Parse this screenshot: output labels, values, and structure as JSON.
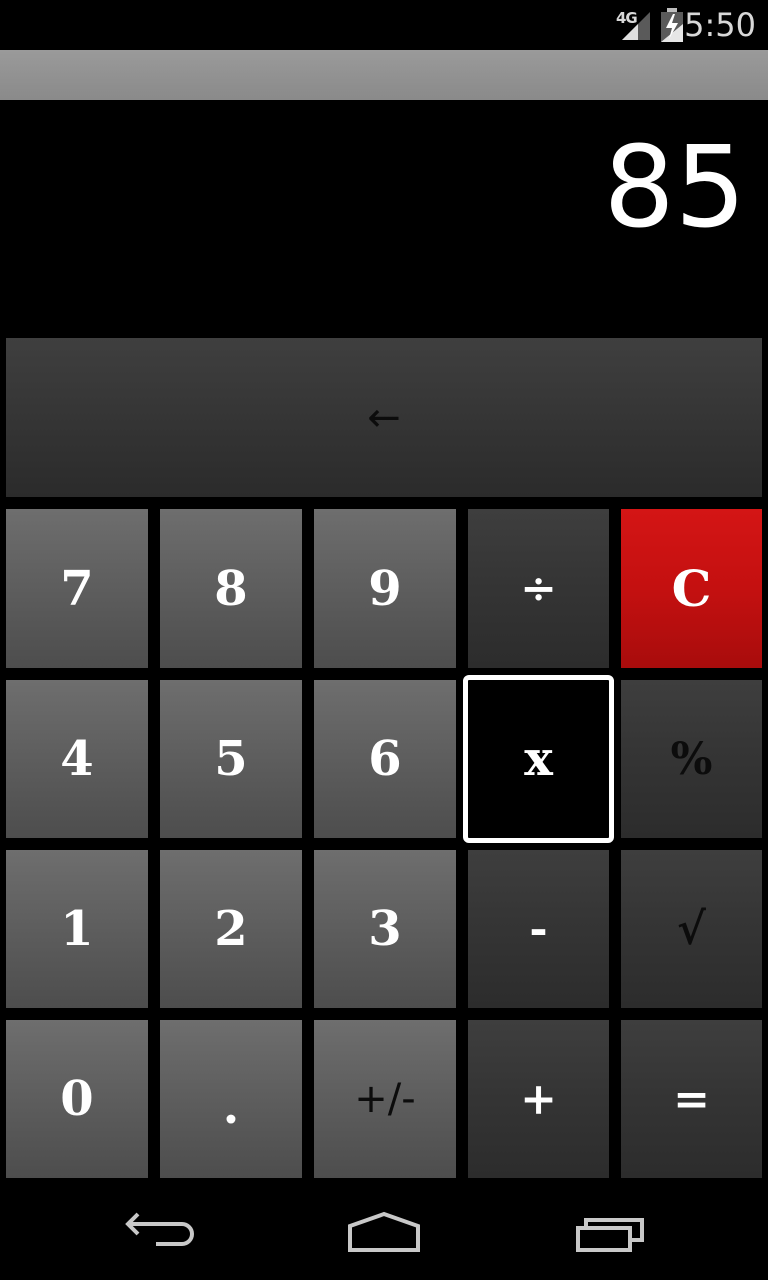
{
  "status_bar": {
    "network": "4G",
    "time": "5:50"
  },
  "display": {
    "value": "85"
  },
  "keys": {
    "backspace": "←",
    "k7": "7",
    "k8": "8",
    "k9": "9",
    "divide": "÷",
    "clear": "C",
    "k4": "4",
    "k5": "5",
    "k6": "6",
    "multiply": "x",
    "percent": "%",
    "k1": "1",
    "k2": "2",
    "k3": "3",
    "minus": "-",
    "sqrt": "√",
    "k0": "0",
    "dot": ".",
    "negate": "+/-",
    "plus": "+",
    "equals": "="
  },
  "colors": {
    "clear_key": "#c41010",
    "number_key": "#5f5f5f",
    "operator_key": "#353535",
    "selected_border": "#ffffff"
  },
  "icons": {
    "nav_back": "back-arrow-icon",
    "nav_home": "home-icon",
    "nav_recents": "recent-apps-icon"
  }
}
